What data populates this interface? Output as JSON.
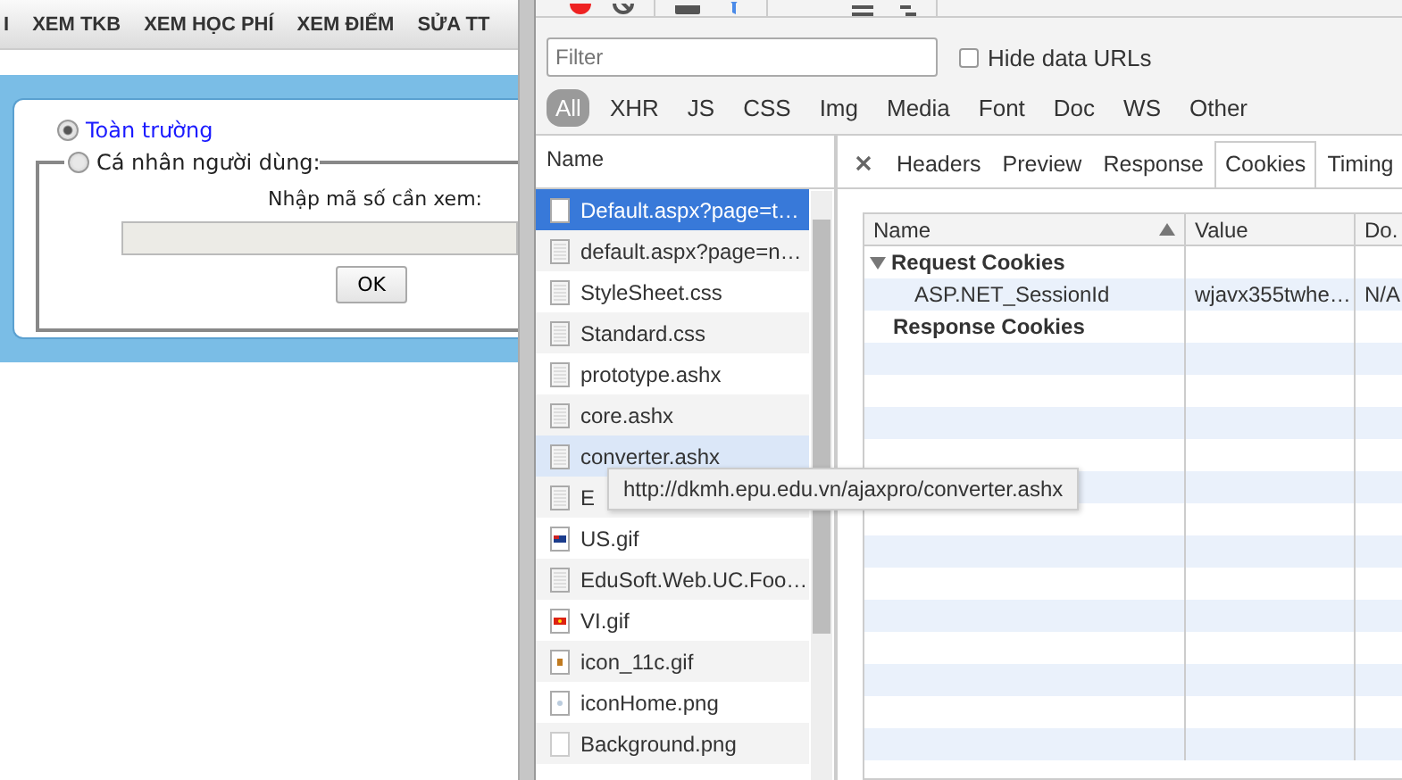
{
  "page": {
    "nav": [
      "I",
      "XEM TKB",
      "XEM HỌC PHÍ",
      "XEM ĐIỂM",
      "SỬA TT"
    ],
    "scope_options": [
      {
        "label": "Toàn trường",
        "selected": true
      },
      {
        "label": "Cá nhân người dùng:",
        "selected": false
      }
    ],
    "code_prompt": "Nhập mã số cần xem:",
    "ok_button": "OK"
  },
  "devtools": {
    "filter": {
      "placeholder": "Filter"
    },
    "hide_data_urls": {
      "label": "Hide data URLs",
      "checked": false
    },
    "type_filters": [
      {
        "label": "All",
        "selected": true
      },
      {
        "label": "XHR",
        "selected": false
      },
      {
        "label": "JS",
        "selected": false
      },
      {
        "label": "CSS",
        "selected": false
      },
      {
        "label": "Img",
        "selected": false
      },
      {
        "label": "Media",
        "selected": false
      },
      {
        "label": "Font",
        "selected": false
      },
      {
        "label": "Doc",
        "selected": false
      },
      {
        "label": "WS",
        "selected": false
      },
      {
        "label": "Other",
        "selected": false
      }
    ],
    "requests": {
      "header": "Name",
      "rows": [
        {
          "name": "Default.aspx?page=t…",
          "kind": "doc",
          "selected": true,
          "hovered": false
        },
        {
          "name": "default.aspx?page=n…",
          "kind": "doc",
          "selected": false,
          "hovered": false
        },
        {
          "name": "StyleSheet.css",
          "kind": "doc",
          "selected": false,
          "hovered": false
        },
        {
          "name": "Standard.css",
          "kind": "doc",
          "selected": false,
          "hovered": false
        },
        {
          "name": "prototype.ashx",
          "kind": "doc",
          "selected": false,
          "hovered": false
        },
        {
          "name": "core.ashx",
          "kind": "doc",
          "selected": false,
          "hovered": false
        },
        {
          "name": "converter.ashx",
          "kind": "doc",
          "selected": false,
          "hovered": true
        },
        {
          "name": "E",
          "kind": "doc",
          "selected": false,
          "hovered": false
        },
        {
          "name": "US.gif",
          "kind": "flag-us",
          "selected": false,
          "hovered": false
        },
        {
          "name": "EduSoft.Web.UC.Foo…",
          "kind": "doc",
          "selected": false,
          "hovered": false
        },
        {
          "name": "VI.gif",
          "kind": "flag-vi",
          "selected": false,
          "hovered": false
        },
        {
          "name": "icon_11c.gif",
          "kind": "dot",
          "selected": false,
          "hovered": false
        },
        {
          "name": "iconHome.png",
          "kind": "image",
          "selected": false,
          "hovered": false
        },
        {
          "name": "Background.png",
          "kind": "blank",
          "selected": false,
          "hovered": false
        }
      ]
    },
    "tooltip": "http://dkmh.epu.edu.vn/ajaxpro/converter.ashx",
    "detail_tabs": [
      {
        "label": "Headers",
        "selected": false
      },
      {
        "label": "Preview",
        "selected": false
      },
      {
        "label": "Response",
        "selected": false
      },
      {
        "label": "Cookies",
        "selected": true
      },
      {
        "label": "Timing",
        "selected": false
      }
    ],
    "cookies": {
      "columns": [
        "Name",
        "Value",
        "Do."
      ],
      "groups": [
        {
          "title": "Request Cookies",
          "expanded": true,
          "rows": [
            {
              "name": "ASP.NET_SessionId",
              "value": "wjavx355twhe…",
              "domain": "N/A"
            }
          ]
        },
        {
          "title": "Response Cookies",
          "expanded": false
        }
      ]
    }
  }
}
